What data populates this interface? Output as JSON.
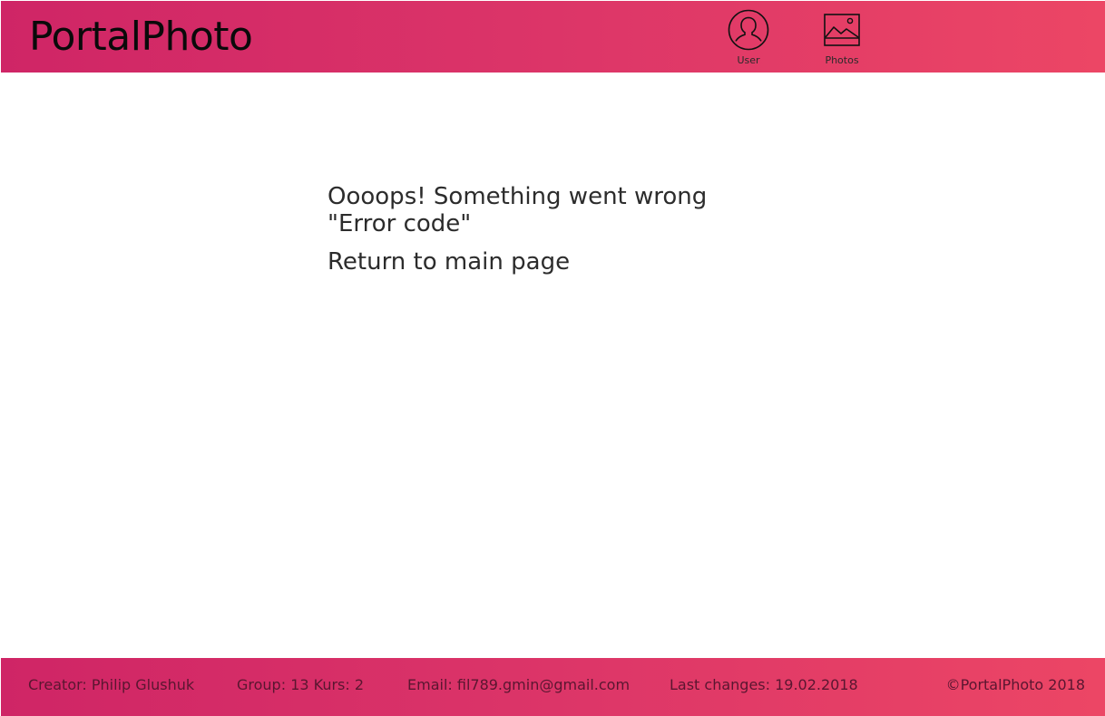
{
  "header": {
    "logo": "PortalPhoto",
    "nav": {
      "user_label": "User",
      "photos_label": "Photos"
    }
  },
  "main": {
    "error_message": "Oooops! Something went wrong",
    "error_code": "\"Error code\"",
    "return_link": "Return to main page"
  },
  "footer": {
    "creator": "Creator: Philip Glushuk",
    "group": "Group: 13 Kurs: 2",
    "email": "Email: fil789.gmin@gmail.com",
    "last_changes": "Last changes: 19.02.2018",
    "copyright": "©PortalPhoto 2018"
  },
  "colors": {
    "header_gradient_start": "#cf2566",
    "header_gradient_end": "#ec4665",
    "text_dark": "#2c2c2c",
    "footer_text": "#5a1630"
  },
  "icons": [
    "user-icon",
    "photos-icon"
  ]
}
